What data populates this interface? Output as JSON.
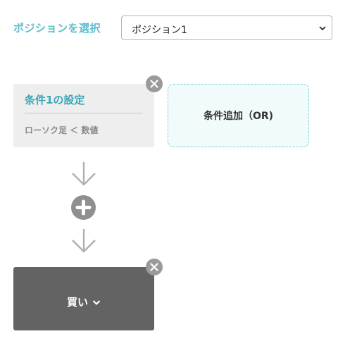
{
  "position": {
    "label": "ポジションを選択",
    "selected": "ポジション1"
  },
  "condition": {
    "title": "条件1の設定",
    "detail": "ローソク足 ＜ 数値"
  },
  "add_condition": {
    "label": "条件追加（OR)"
  },
  "action": {
    "label": "買い"
  },
  "colors": {
    "accent": "#3aa7b8",
    "label_accent": "#5bbccc",
    "action_bg": "#636363",
    "add_border": "#7ccfd8"
  },
  "icons": {
    "select": "chevron-down-icon",
    "remove": "close-icon",
    "flow": "arrow-down-icon",
    "insert": "plus-icon"
  }
}
